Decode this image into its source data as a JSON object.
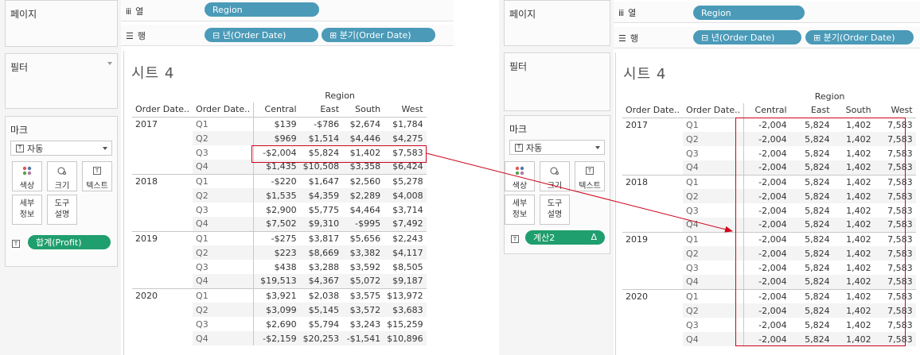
{
  "labels": {
    "pages": "페이지",
    "columns": "열",
    "rows": "행",
    "filters": "필터",
    "marks": "마크",
    "mark_type": "자동",
    "color": "색상",
    "size": "크기",
    "text": "텍스트",
    "detail": "세부\n정보",
    "detail_l1": "세부",
    "detail_l2": "정보",
    "tooltip_l1": "도구",
    "tooltip_l2": "설명",
    "sheet_title": "시트 4",
    "region": "Region",
    "col_year_hdr": "Order Date..",
    "col_qtr_hdr": "Order Date..",
    "text_glyph": "T",
    "delta_glyph": "Δ",
    "columns_sym": "iii",
    "rows_sym": "☰"
  },
  "pills": {
    "region": "Region",
    "year": "⊟ 년(Order Date)",
    "quarter": "⊞ 분기(Order Date)",
    "profit_sum": "합계(Profit)",
    "calc2": "계산2"
  },
  "regions": [
    "Central",
    "East",
    "South",
    "West"
  ],
  "quarters": [
    "Q1",
    "Q2",
    "Q3",
    "Q4"
  ],
  "years": [
    "2017",
    "2018",
    "2019",
    "2020"
  ],
  "left_table": [
    [
      [
        "$139",
        "-$786",
        "$2,674",
        "$1,784"
      ],
      [
        "$969",
        "$1,514",
        "$4,446",
        "$4,275"
      ],
      [
        "-$2,004",
        "$5,824",
        "$1,402",
        "$7,583"
      ],
      [
        "$1,435",
        "$10,508",
        "$3,358",
        "$6,424"
      ]
    ],
    [
      [
        "-$220",
        "$1,647",
        "$2,560",
        "$5,278"
      ],
      [
        "$1,535",
        "$4,359",
        "$2,289",
        "$4,008"
      ],
      [
        "$2,900",
        "$5,775",
        "$4,464",
        "$3,714"
      ],
      [
        "$7,502",
        "$9,310",
        "-$995",
        "$7,492"
      ]
    ],
    [
      [
        "-$275",
        "$3,817",
        "$5,656",
        "$2,243"
      ],
      [
        "$223",
        "$8,669",
        "$3,382",
        "$4,117"
      ],
      [
        "$438",
        "$3,288",
        "$3,592",
        "$8,505"
      ],
      [
        "$19,513",
        "$4,367",
        "$5,072",
        "$9,187"
      ]
    ],
    [
      [
        "$3,921",
        "$2,038",
        "$3,575",
        "$13,972"
      ],
      [
        "$3,099",
        "$5,145",
        "$3,572",
        "$3,683"
      ],
      [
        "$2,690",
        "$5,794",
        "$3,243",
        "$15,259"
      ],
      [
        "-$2,159",
        "$20,253",
        "-$1,541",
        "$10,896"
      ]
    ]
  ],
  "right_row": [
    "-2,004",
    "5,824",
    "1,402",
    "7,583"
  ],
  "colors": {
    "pill_blue": "#4a9ab8",
    "pill_green": "#1f9e6e",
    "highlight_red": "#d0021b"
  }
}
